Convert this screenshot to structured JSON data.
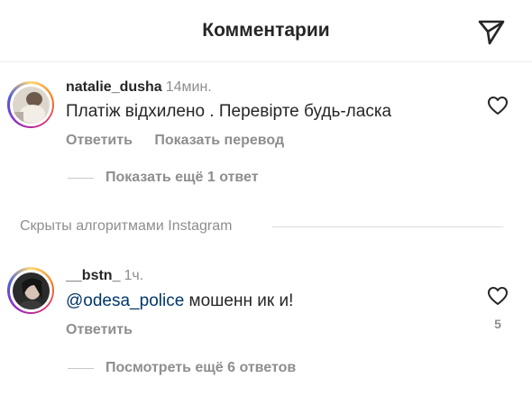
{
  "header": {
    "title": "Комментарии",
    "share_icon": "paper-plane-icon"
  },
  "comments": [
    {
      "username": "natalie_dusha",
      "time": "14мин.",
      "text": "Платіж відхилено . Перевірте будь-ласка",
      "reply_label": "Ответить",
      "translate_label": "Показать перевод",
      "thread_label": "Показать ещё 1 ответ",
      "like_icon": "heart-outline-icon"
    },
    {
      "username": "__bstn_",
      "time": "1ч.",
      "mention": "@odesa_police",
      "text": " мошенн ик и!",
      "reply_label": "Ответить",
      "likes": "5",
      "thread_label": "Посмотреть ещё 6 ответов",
      "like_icon": "heart-outline-icon"
    }
  ],
  "hidden_section": {
    "label": "Скрыты алгоритмами Instagram"
  },
  "colors": {
    "text": "#262626",
    "secondary": "#8e8e8e",
    "mention": "#00376b",
    "story_ring": [
      "#feda75",
      "#fa7e1e",
      "#d62976",
      "#962fbf",
      "#4f5bd5"
    ]
  }
}
